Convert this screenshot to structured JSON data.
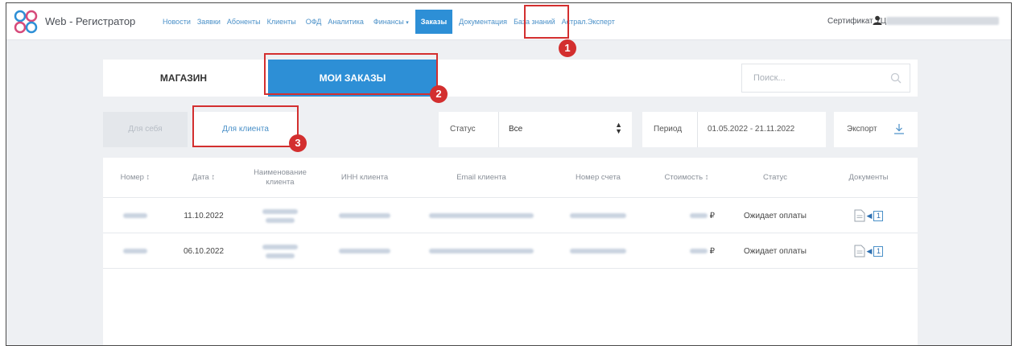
{
  "app": {
    "title": "Web - Регистратор"
  },
  "nav": {
    "items": [
      {
        "label": "Новости"
      },
      {
        "label": "Заявки"
      },
      {
        "label": "Абоненты"
      },
      {
        "label": "Клиенты"
      },
      {
        "label": "ОФД"
      },
      {
        "label": "Аналитика"
      },
      {
        "label": "Финансы"
      },
      {
        "label": "Заказы",
        "active": true
      },
      {
        "label": "Документация"
      },
      {
        "label": "База знаний"
      },
      {
        "label": "Астрал.Эксперт"
      }
    ],
    "certificate": "Сертификат УЦ"
  },
  "tabs": {
    "shop": "МАГАЗИН",
    "my_orders": "МОИ ЗАКАЗЫ"
  },
  "search": {
    "placeholder": "Поиск..."
  },
  "filters": {
    "for_self": "Для себя",
    "for_client": "Для клиента",
    "status_label": "Статус",
    "status_value": "Все",
    "period_label": "Период",
    "period_value": "01.05.2022 - 21.11.2022",
    "export_label": "Экспорт"
  },
  "table": {
    "columns": [
      "Номер ↕",
      "Дата ↕",
      "Наименование клиента",
      "ИНН клиента",
      "Email клиента",
      "Номер счета",
      "Стоимость ↕",
      "Статус",
      "Документы"
    ],
    "rows": [
      {
        "date": "11.10.2022",
        "currency": "₽",
        "status": "Ожидает оплаты",
        "doc_count": "1"
      },
      {
        "date": "06.10.2022",
        "currency": "₽",
        "status": "Ожидает оплаты",
        "doc_count": "1"
      }
    ]
  },
  "callouts": [
    "1",
    "2",
    "3"
  ],
  "colors": {
    "accent": "#2d8fd6",
    "callout": "#d32f2f",
    "link": "#4a90c8"
  }
}
